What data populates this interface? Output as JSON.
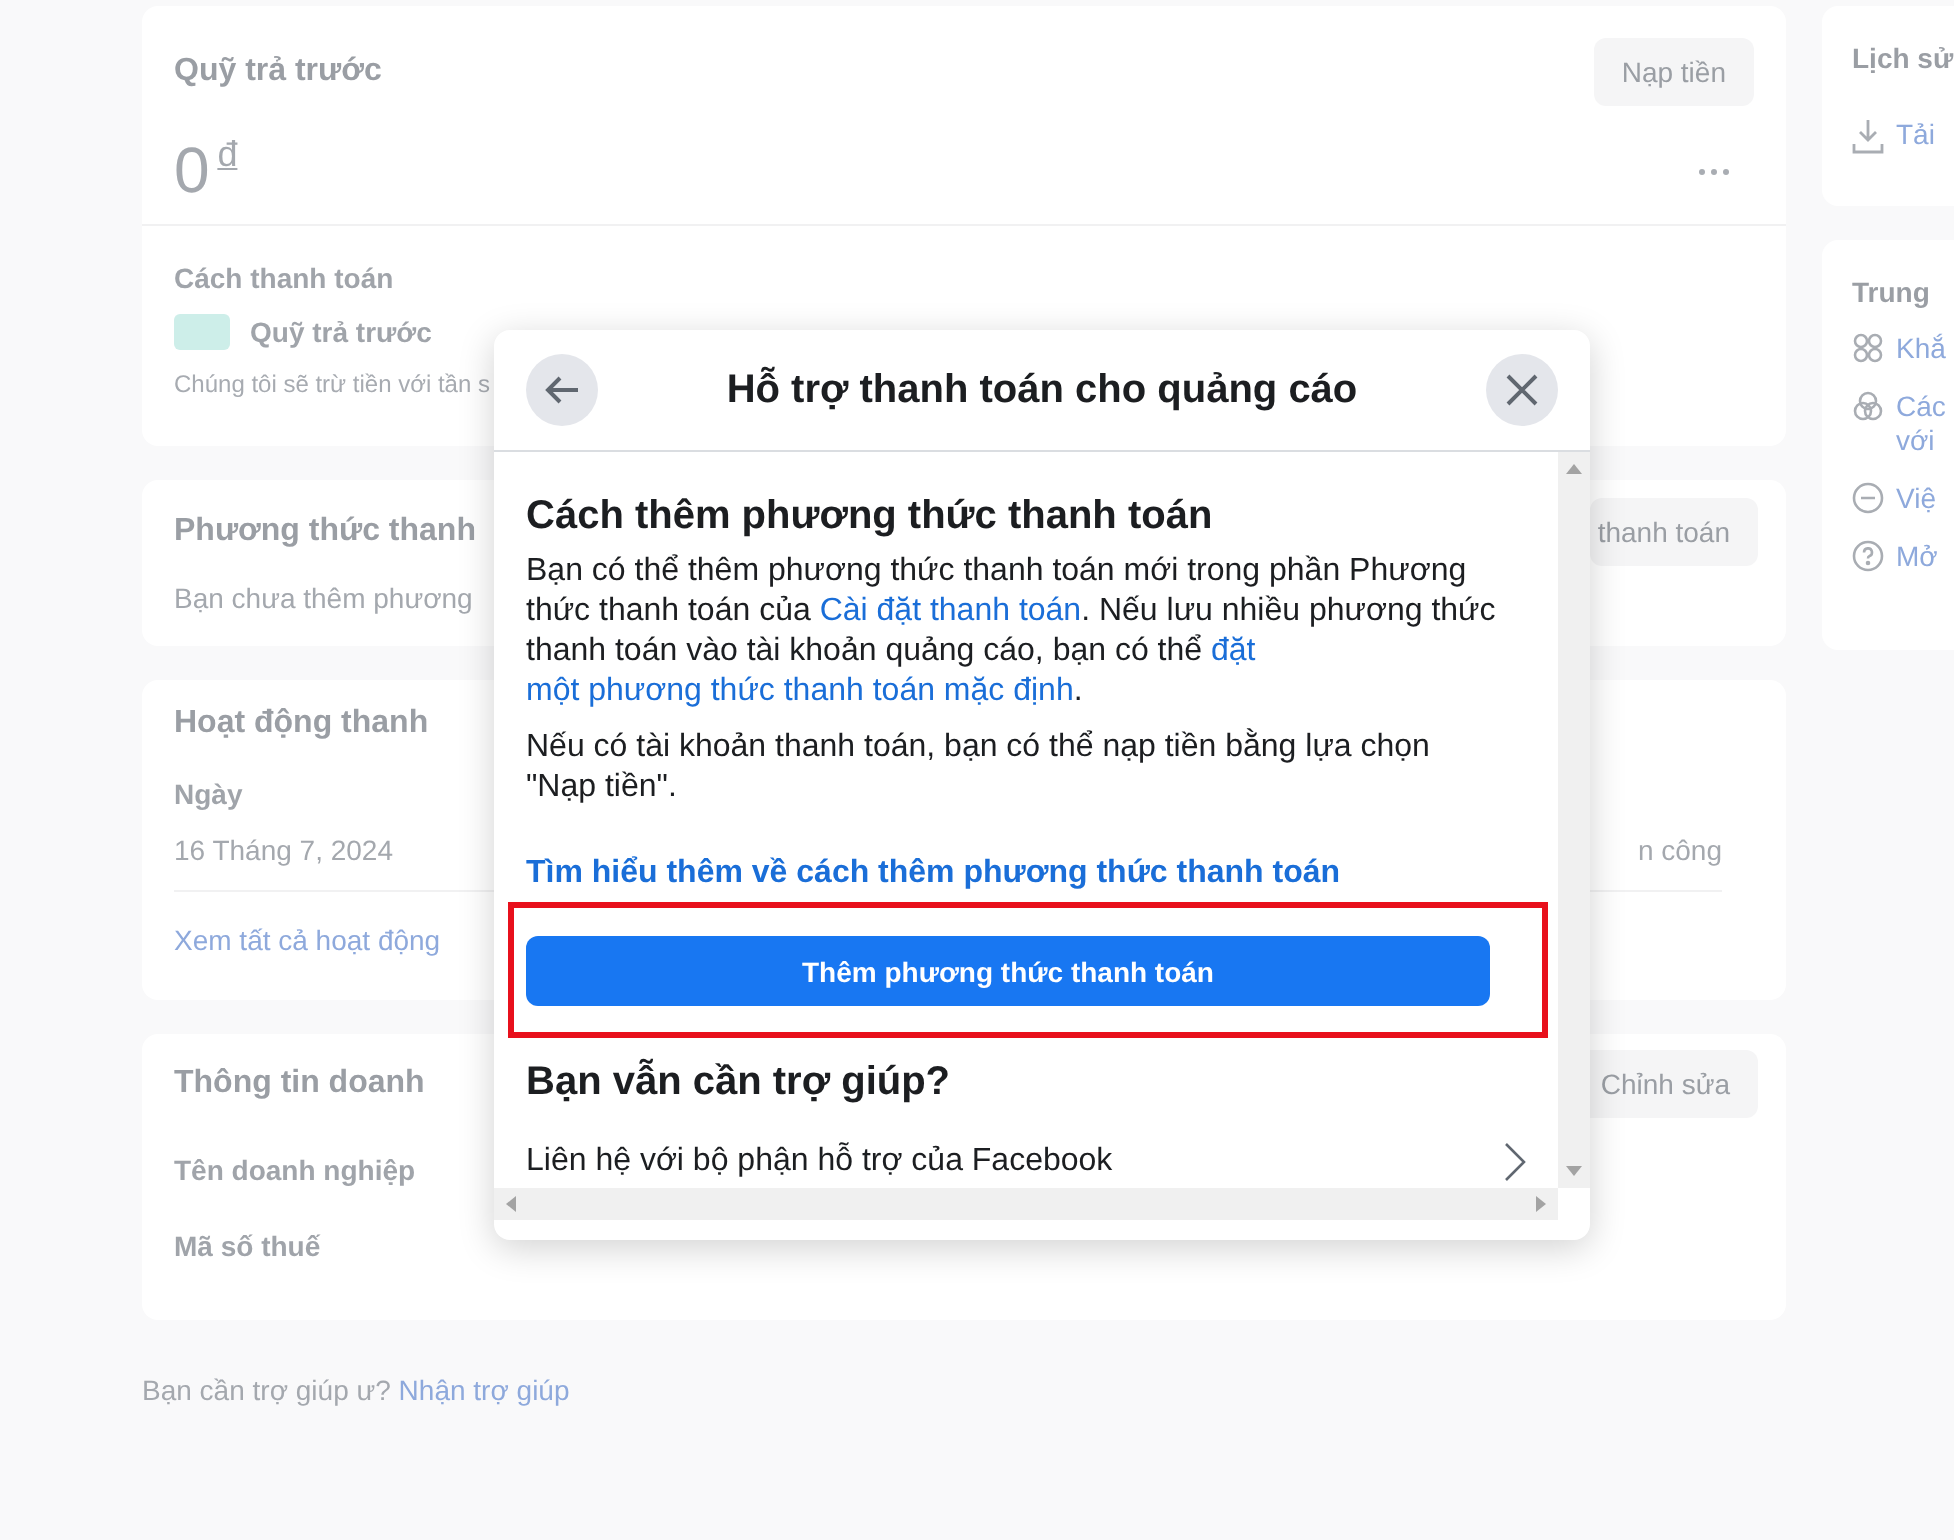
{
  "prepaid_card": {
    "title": "Quỹ trả trước",
    "button": "Nạp tiền",
    "balance": "0",
    "currency": "đ",
    "payment_method_label": "Cách thanh toán",
    "payment_method": "Quỹ trả trước",
    "note": "Chúng tôi sẽ trừ tiền với tần s"
  },
  "payment_methods_card": {
    "title": "Phương thức thanh",
    "button": "thanh toán",
    "empty_text": "Bạn chưa thêm phương"
  },
  "activity_card": {
    "title": "Hoạt động thanh",
    "column_1": "Ngày",
    "rows": [
      {
        "date": "16 Tháng 7, 2024",
        "column_2": "n công"
      }
    ],
    "link": "Xem tất cả hoạt động"
  },
  "business_card": {
    "title": "Thông tin doanh",
    "button": "Chỉnh sửa",
    "fields": [
      "Tên doanh nghiệp",
      "Mã số thuế"
    ]
  },
  "footer": {
    "text": "Bạn cần trợ giúp ư?",
    "link": "Nhận trợ giúp"
  },
  "history_card": {
    "title": "Lịch sử",
    "items": [
      {
        "kind": "download",
        "lines": [
          "Tải"
        ]
      }
    ]
  },
  "help_center_card": {
    "title": "Trung",
    "items": [
      {
        "kind": "flower",
        "lines": [
          "Khắ"
        ]
      },
      {
        "kind": "circles",
        "lines": [
          "Các",
          "với"
        ]
      },
      {
        "kind": "minus",
        "lines": [
          "Việ"
        ]
      },
      {
        "kind": "question",
        "lines": [
          "Mở"
        ]
      }
    ]
  },
  "dialog": {
    "title": "Hỗ trợ thanh toán cho quảng cáo",
    "heading": "Cách thêm phương thức thanh toán",
    "paragraphs": [
      [
        {
          "text": "Bạn có thể thêm phương thức thanh toán mới trong phần Phương thức thanh toán của ",
          "link": false
        },
        {
          "text": "Cài đặt thanh toán",
          "link": true
        },
        {
          "text": ". Nếu lưu nhiều phương thức thanh toán vào tài khoản quảng cáo, bạn có thể ",
          "link": false
        },
        {
          "text": "đặt ",
          "link": true
        },
        {
          "text": "một phương thức thanh toán mặc định",
          "link": true
        },
        {
          "text": ".",
          "link": false
        }
      ],
      [
        {
          "text": "Nếu có tài khoản thanh toán, bạn có thể nạp tiền bằng lựa chọn \"Nạp tiền\".",
          "link": false
        }
      ]
    ],
    "learn_more": "Tìm hiểu thêm về cách thêm phương thức thanh toán",
    "primary_button": "Thêm phương thức thanh toán",
    "help_heading": "Bạn vẫn cần trợ giúp?",
    "contact": "Liên hệ với bộ phận hỗ trợ của Facebook"
  }
}
